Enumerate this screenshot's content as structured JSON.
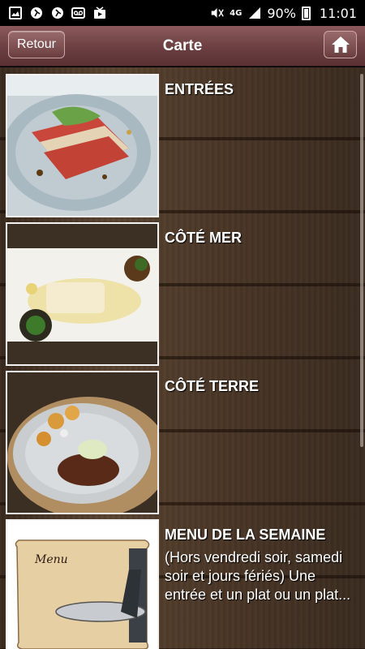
{
  "status_bar": {
    "network": "4G",
    "battery_percent": "90%",
    "time": "11:01"
  },
  "header": {
    "back_label": "Retour",
    "title": "Carte"
  },
  "menu_items": [
    {
      "title": "ENTRÉES",
      "description": ""
    },
    {
      "title": "CÔTÉ MER",
      "description": ""
    },
    {
      "title": "CÔTÉ TERRE",
      "description": ""
    },
    {
      "title": "MENU DE LA SEMAINE",
      "description": "(Hors vendredi soir, samedi soir et jours fériés) Une entrée et un plat ou un plat...",
      "image_caption": "Menu"
    }
  ],
  "colors": {
    "header_top": "#8c5a5c",
    "header_bottom": "#5a3134",
    "text": "#ffffff"
  }
}
